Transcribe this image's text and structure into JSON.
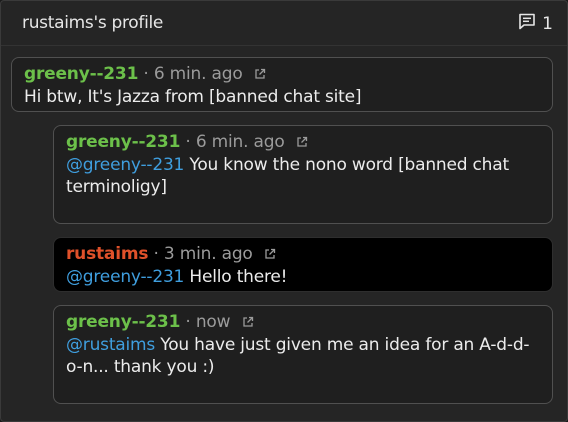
{
  "header": {
    "title": "rustaims's profile",
    "comment_count": "1"
  },
  "comments": [
    {
      "user": "greeny--231",
      "sep": "·",
      "time": "6 min. ago",
      "mention": "",
      "text": "Hi btw, It's Jazza from [banned chat site]"
    },
    {
      "user": "greeny--231",
      "sep": "·",
      "time": "6 min. ago",
      "mention": "@greeny--231",
      "text": "You know the nono word [banned chat terminoligy]"
    },
    {
      "user": "rustaims",
      "sep": "·",
      "time": "3 min. ago",
      "mention": "@greeny--231",
      "text": "Hello there!"
    },
    {
      "user": "greeny--231",
      "sep": "·",
      "time": "now",
      "mention": "@rustaims",
      "text": "You have just given me an idea for an A-d-d-o-n... thank you :)"
    }
  ],
  "colors": {
    "username_green": "#6cc04a",
    "username_red": "#e0512a",
    "mention_blue": "#3f9ede"
  }
}
